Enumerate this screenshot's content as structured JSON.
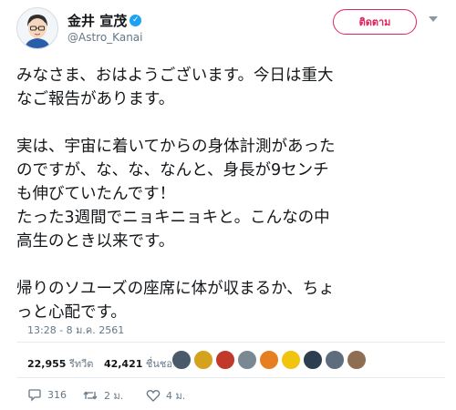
{
  "user": {
    "display_name": "金井 宣茂",
    "handle": "@Astro_Kanai",
    "follow_label": "ติดตาม"
  },
  "tweet": {
    "paragraphs": [
      [
        "みなさま、おはようございます。今日は重大",
        "なご報告があります。"
      ],
      [
        "実は、宇宙に着いてからの身体計測があった",
        "のですが、な、な、なんと、身長が9センチ",
        "も伸びていたんです！",
        "たった3週間でニョキニョキと。こんなの中",
        "高生のとき以来です。"
      ],
      [
        "帰りのソユーズの座席に体が収まるか、ちょ",
        "っと心配です。"
      ]
    ],
    "timestamp": "13:28 - 8 ม.ค. 2561"
  },
  "stats": {
    "retweets_count": "22,955",
    "retweets_label": "รีทวีต",
    "likes_count": "42,421",
    "likes_label": "ชื่นชอบ"
  },
  "actions": {
    "reply_count": "316",
    "retweet_count": "2 ม.",
    "like_count": "4 ม."
  },
  "colors": {
    "follow_accent": "#e0245e",
    "verified_blue": "#1da1f2",
    "muted_text": "#657786"
  },
  "icons": [
    "verified-badge-icon",
    "caret-down-icon",
    "reply-icon",
    "retweet-icon",
    "like-icon"
  ]
}
